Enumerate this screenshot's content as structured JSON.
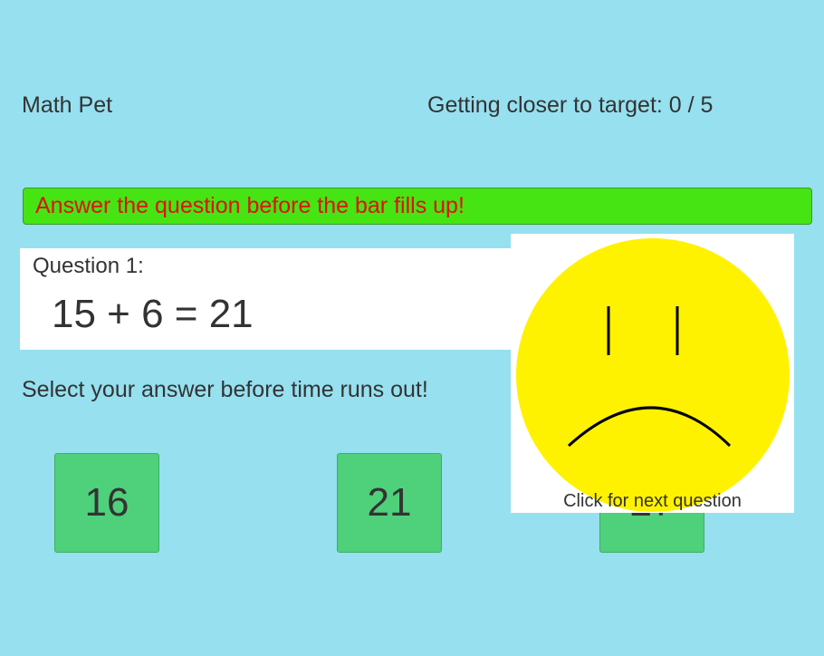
{
  "header": {
    "app_title": "Math Pet",
    "progress_text": "Getting closer to target: 0 / 5"
  },
  "timer_bar": {
    "message": "Answer the question before the bar fills up!",
    "color": "#46e412",
    "message_color": "#e01010"
  },
  "question": {
    "label": "Question 1:",
    "equation": "15 + 6 = 21"
  },
  "instruction": "Select your answer before time runs out!",
  "answers": [
    {
      "label": "16"
    },
    {
      "label": "21"
    },
    {
      "label": "27"
    }
  ],
  "feedback": {
    "icon": "sad-face-icon",
    "face_color": "#fff200",
    "next_label": "Click for next question"
  },
  "colors": {
    "background": "#96e0f0",
    "button": "#4fd07a",
    "panel": "#ffffff"
  }
}
